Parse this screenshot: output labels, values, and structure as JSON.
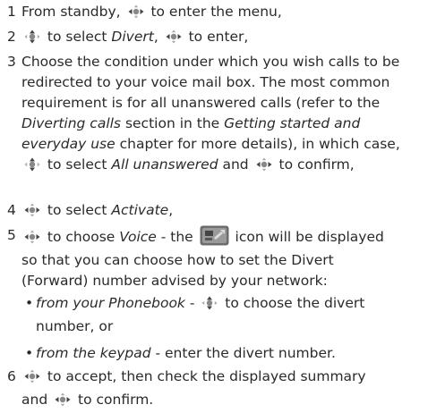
{
  "steps": [
    {
      "num": "1",
      "parts": [
        "From standby, ",
        " to enter the menu,"
      ]
    },
    {
      "num": "2",
      "parts": [
        " to select ",
        "Divert",
        ", ",
        " to enter,"
      ]
    },
    {
      "num": "3",
      "lines": [
        "Choose the condition under which you wish calls to be",
        "redirected to your voice mail box. The most common",
        "requirement is for all unanswered calls (refer to the",
        [
          "Diverting calls",
          " section in the ",
          "Getting started and"
        ],
        [
          "everyday use",
          " chapter for more details), in which case,"
        ],
        [
          " to select ",
          "All unanswered",
          " and ",
          " to confirm,"
        ]
      ]
    },
    {
      "num": "4",
      "parts": [
        " to select ",
        "Activate",
        ","
      ]
    },
    {
      "num": "5",
      "lines": [
        [
          " to choose ",
          "Voice",
          " - the ",
          " icon will be displayed"
        ],
        "so that you can choose how to set the Divert",
        "(Forward) number advised by your network:"
      ]
    },
    {
      "sub1": [
        "from your Phonebook",
        " - ",
        " to choose the divert",
        "number, or"
      ]
    },
    {
      "sub2": [
        "from the keypad",
        " - enter the divert number."
      ]
    },
    {
      "num": "6",
      "lines": [
        [
          " to accept, then check the displayed summary"
        ],
        [
          "and ",
          " to confirm."
        ]
      ]
    }
  ],
  "icons": {
    "nav_lr": "nav-left-right-icon",
    "nav_ud": "nav-up-down-icon",
    "divert": "divert-screen-icon"
  }
}
